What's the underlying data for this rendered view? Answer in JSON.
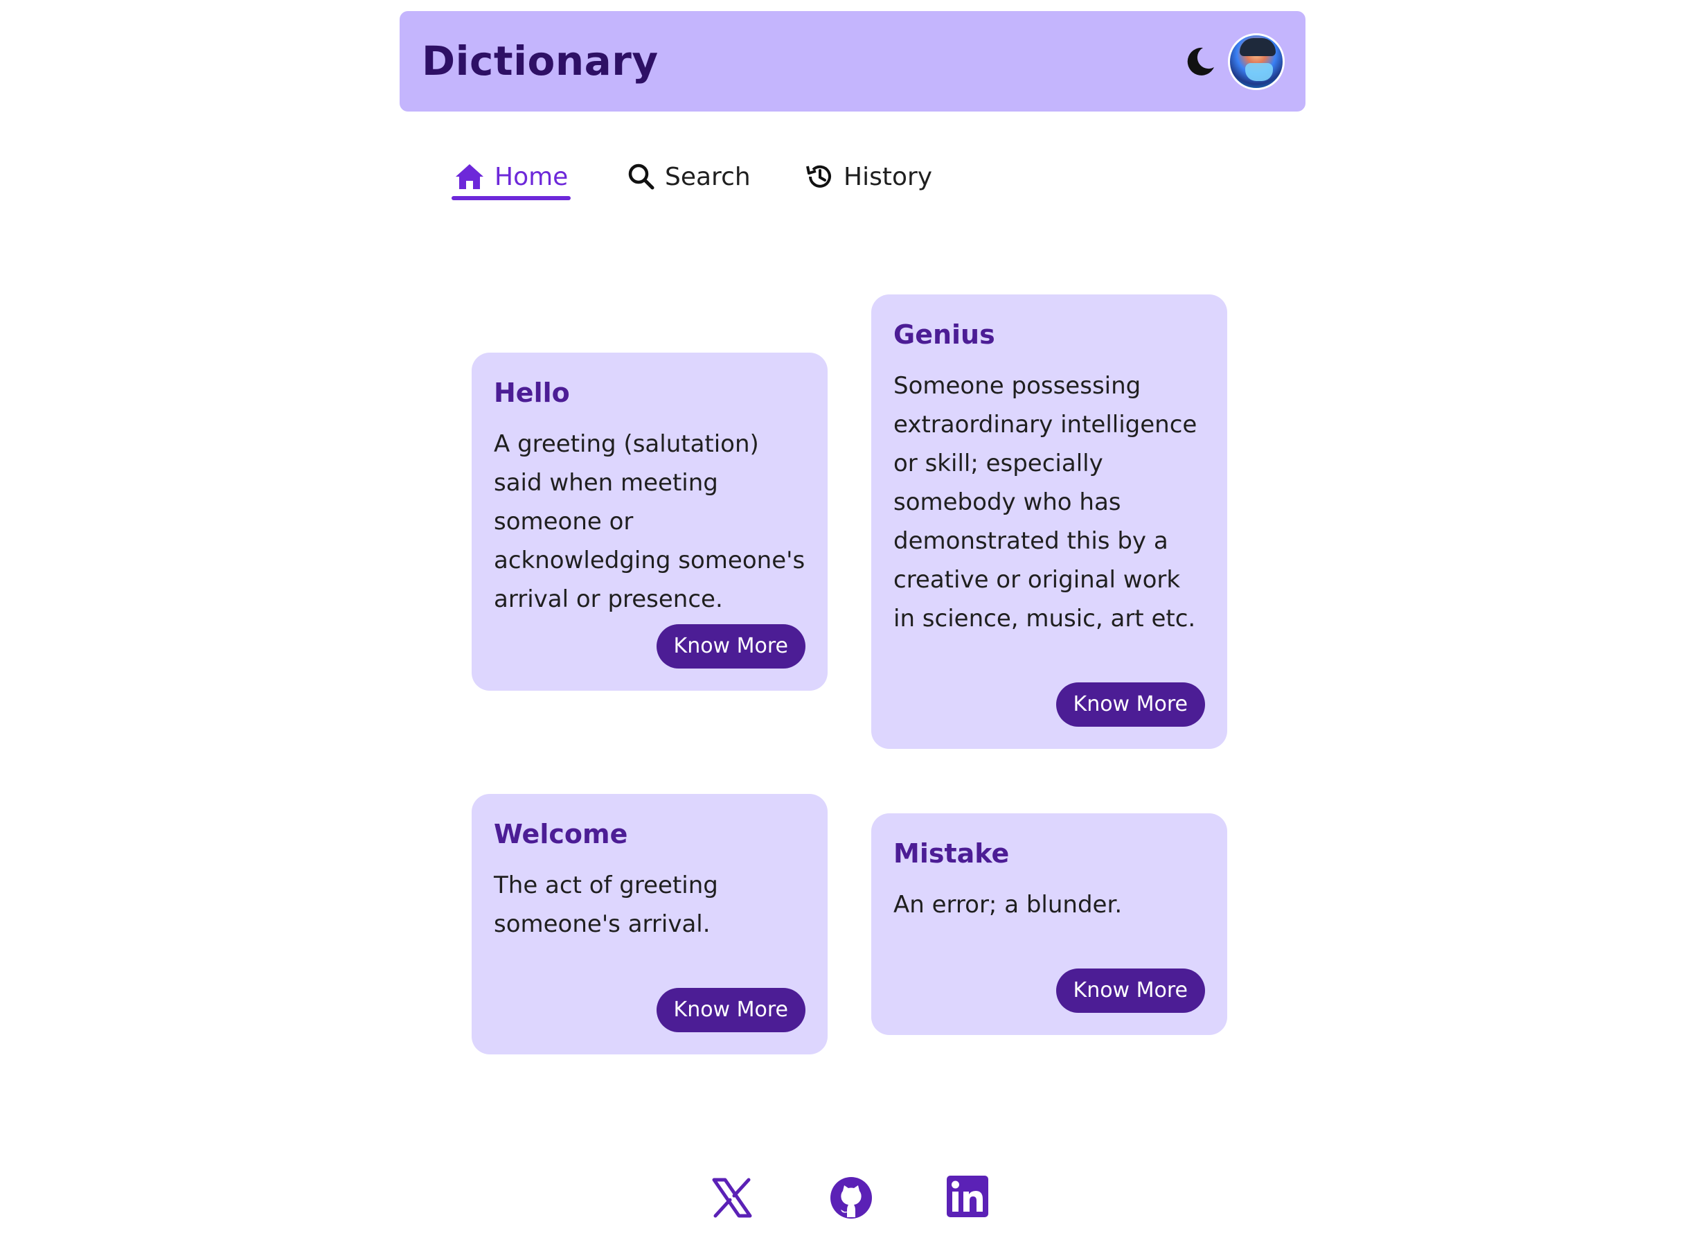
{
  "header": {
    "title": "Dictionary",
    "theme_toggle_icon": "moon-icon",
    "avatar_icon": "user-avatar"
  },
  "nav": {
    "tabs": [
      {
        "label": "Home",
        "icon": "home-icon",
        "active": true
      },
      {
        "label": "Search",
        "icon": "search-icon",
        "active": false
      },
      {
        "label": "History",
        "icon": "history-icon",
        "active": false
      }
    ]
  },
  "cards": [
    {
      "word": "Hello",
      "definition": "A greeting (salutation) said when meeting someone or acknowledging someone's arrival or presence.",
      "button": "Know More"
    },
    {
      "word": "Genius",
      "definition": "Someone possessing extraordinary intelligence or skill; especially somebody who has demonstrated this by a creative or original work in science, music, art etc.",
      "button": "Know More"
    },
    {
      "word": "Welcome",
      "definition": "The act of greeting someone's arrival.",
      "button": "Know More"
    },
    {
      "word": "Mistake",
      "definition": "An error; a blunder.",
      "button": "Know More"
    }
  ],
  "footer": {
    "links": [
      {
        "icon": "x-twitter-icon"
      },
      {
        "icon": "github-icon"
      },
      {
        "icon": "linkedin-icon"
      }
    ]
  },
  "colors": {
    "header_bg": "#c4b5fd",
    "card_bg": "#ddd6fe",
    "accent": "#6d28d9",
    "title_dark": "#2e1065",
    "button_bg": "#4c1d95"
  }
}
